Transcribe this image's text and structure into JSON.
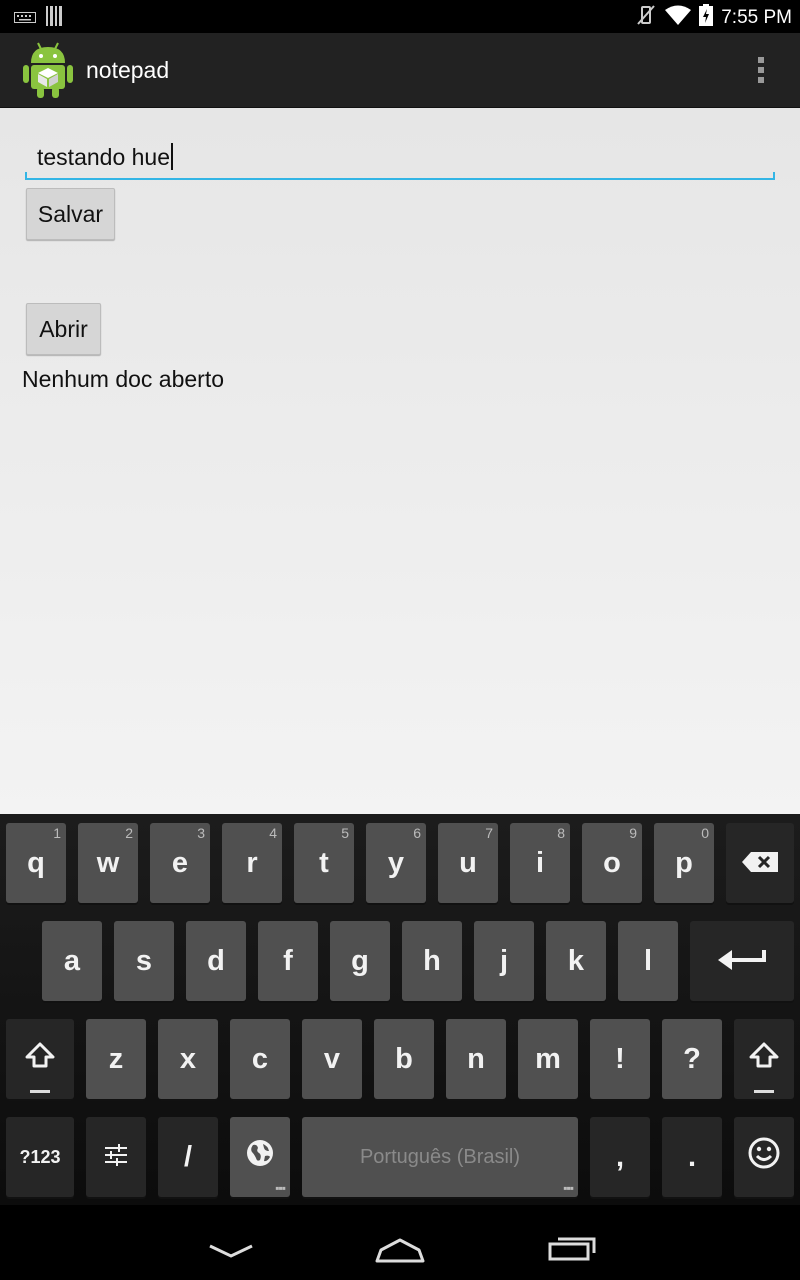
{
  "status_bar": {
    "time": "7:55 PM"
  },
  "action_bar": {
    "title": "notepad"
  },
  "content": {
    "editor_value": "testando hue",
    "save_button": "Salvar",
    "open_button": "Abrir",
    "status_text": "Nenhum doc aberto"
  },
  "keyboard": {
    "row1": [
      {
        "label": "q",
        "hint": "1"
      },
      {
        "label": "w",
        "hint": "2"
      },
      {
        "label": "e",
        "hint": "3"
      },
      {
        "label": "r",
        "hint": "4"
      },
      {
        "label": "t",
        "hint": "5"
      },
      {
        "label": "y",
        "hint": "6"
      },
      {
        "label": "u",
        "hint": "7"
      },
      {
        "label": "i",
        "hint": "8"
      },
      {
        "label": "o",
        "hint": "9"
      },
      {
        "label": "p",
        "hint": "0"
      }
    ],
    "row2": [
      "a",
      "s",
      "d",
      "f",
      "g",
      "h",
      "j",
      "k",
      "l"
    ],
    "row3": [
      "z",
      "x",
      "c",
      "v",
      "b",
      "n",
      "m",
      "!",
      "?"
    ],
    "symbols_key": "?123",
    "slash_key": "/",
    "space_label": "Português (Brasil)",
    "comma_key": ",",
    "period_key": ".",
    "icons": {
      "backspace": "backspace-icon",
      "enter": "enter-icon",
      "shift": "shift-icon",
      "settings": "settings-sliders-icon",
      "language": "globe-icon",
      "emoji": "emoji-icon"
    }
  },
  "colors": {
    "accent": "#33b5e5",
    "action_bar": "#222222",
    "key": "#505050"
  }
}
